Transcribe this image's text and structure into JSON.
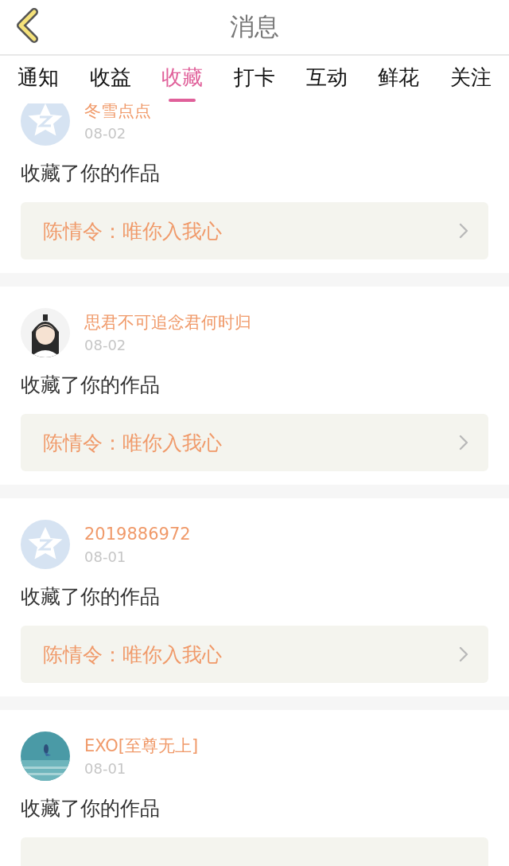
{
  "header": {
    "title": "消息"
  },
  "tabs": [
    {
      "label": "通知",
      "selected": false
    },
    {
      "label": "收益",
      "selected": false
    },
    {
      "label": "收藏",
      "selected": true
    },
    {
      "label": "打卡",
      "selected": false
    },
    {
      "label": "互动",
      "selected": false
    },
    {
      "label": "鲜花",
      "selected": false
    },
    {
      "label": "关注",
      "selected": false
    }
  ],
  "messages": [
    {
      "avatar": {
        "kind": "default"
      },
      "name": "冬雪点点",
      "date": "08-02",
      "text": "收藏了你的作品",
      "link": "陈情令：唯你入我心"
    },
    {
      "avatar": {
        "kind": "figure"
      },
      "name": "思君不可追念君何时归",
      "date": "08-02",
      "text": "收藏了你的作品",
      "link": "陈情令：唯你入我心"
    },
    {
      "avatar": {
        "kind": "default"
      },
      "name": "2019886972",
      "date": "08-01",
      "text": "收藏了你的作品",
      "link": "陈情令：唯你入我心"
    },
    {
      "avatar": {
        "kind": "scene"
      },
      "name": "EXO[至尊无上]",
      "date": "08-01",
      "text": "收藏了你的作品"
    }
  ]
}
